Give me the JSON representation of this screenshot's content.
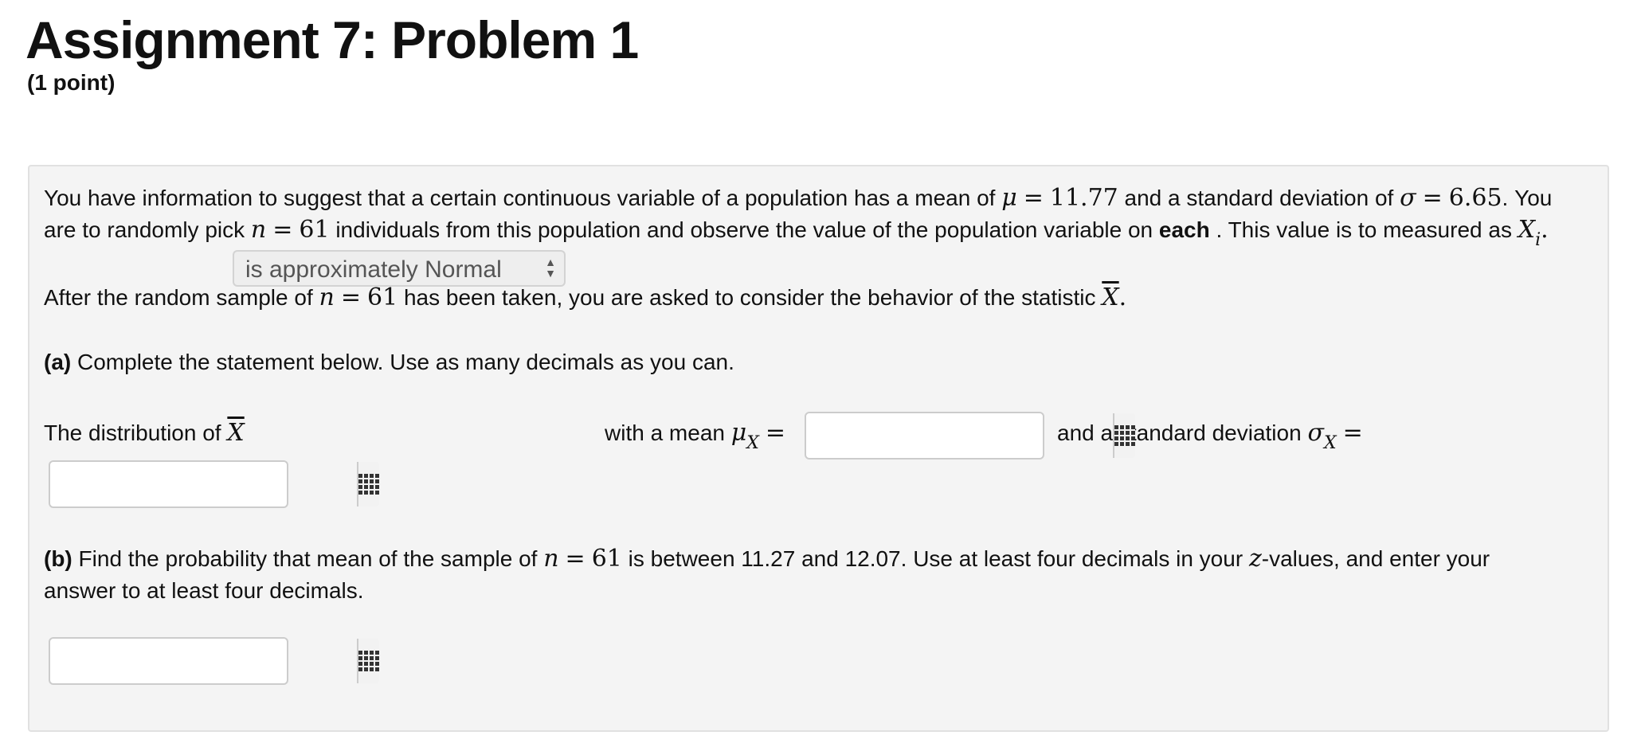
{
  "header": {
    "title": "Assignment 7: Problem 1",
    "points": "(1 point)"
  },
  "problem": {
    "p1_a": "You have information to suggest that a certain continuous variable of a population has a mean of",
    "mu": "μ",
    "eq": "=",
    "mean_value": "11.77",
    "p1_b": "and a standard deviation of",
    "sigma": "σ",
    "sd_value": "6.65",
    "p1_c": ". You",
    "p2_a": "are to randomly pick",
    "n_var": "n",
    "n_value": "61",
    "p2_b": "individuals from this population and observe the value of the population variable on",
    "p2_bold": "each",
    "p2_c": ". This value is to measured as",
    "xi_var": "X",
    "xi_sub": "i",
    "period": ".",
    "p3_a": "After the random sample of",
    "p3_b": "has been taken, you are asked to consider the behavior of the statistic",
    "xbar": "X",
    "part_a_label": "(a)",
    "part_a_text": "Complete the statement below. Use as many decimals as you can.",
    "stmt_a": "The distribution of",
    "select_value": "is approximately Normal",
    "stmt_b": "with a mean",
    "mu_sub": "X",
    "stmt_c": "and a standard deviation",
    "sigma_sub": "X",
    "part_b_label": "(b)",
    "part_b_text_a": "Find the probability that mean of the sample of",
    "part_b_text_b": "is between 11.27 and 12.07. Use at least four decimals in your",
    "z_var": "z",
    "part_b_text_c": "-values, and enter your",
    "part_b_line2": "answer to at least four decimals."
  },
  "inputs": {
    "mean_answer": "",
    "sd_answer": "",
    "prob_answer": ""
  }
}
